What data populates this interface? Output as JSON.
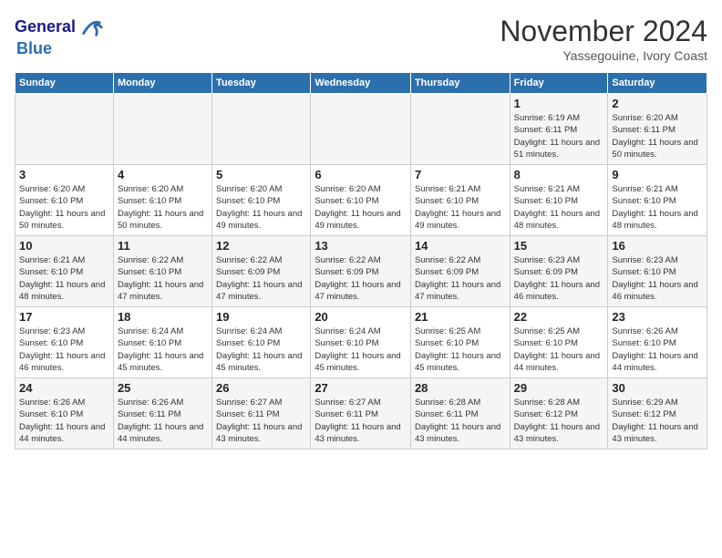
{
  "header": {
    "logo_line1": "General",
    "logo_line2": "Blue",
    "month_title": "November 2024",
    "subtitle": "Yassegouine, Ivory Coast"
  },
  "weekdays": [
    "Sunday",
    "Monday",
    "Tuesday",
    "Wednesday",
    "Thursday",
    "Friday",
    "Saturday"
  ],
  "weeks": [
    [
      {
        "day": "",
        "info": ""
      },
      {
        "day": "",
        "info": ""
      },
      {
        "day": "",
        "info": ""
      },
      {
        "day": "",
        "info": ""
      },
      {
        "day": "",
        "info": ""
      },
      {
        "day": "1",
        "info": "Sunrise: 6:19 AM\nSunset: 6:11 PM\nDaylight: 11 hours and 51 minutes."
      },
      {
        "day": "2",
        "info": "Sunrise: 6:20 AM\nSunset: 6:11 PM\nDaylight: 11 hours and 50 minutes."
      }
    ],
    [
      {
        "day": "3",
        "info": "Sunrise: 6:20 AM\nSunset: 6:10 PM\nDaylight: 11 hours and 50 minutes."
      },
      {
        "day": "4",
        "info": "Sunrise: 6:20 AM\nSunset: 6:10 PM\nDaylight: 11 hours and 50 minutes."
      },
      {
        "day": "5",
        "info": "Sunrise: 6:20 AM\nSunset: 6:10 PM\nDaylight: 11 hours and 49 minutes."
      },
      {
        "day": "6",
        "info": "Sunrise: 6:20 AM\nSunset: 6:10 PM\nDaylight: 11 hours and 49 minutes."
      },
      {
        "day": "7",
        "info": "Sunrise: 6:21 AM\nSunset: 6:10 PM\nDaylight: 11 hours and 49 minutes."
      },
      {
        "day": "8",
        "info": "Sunrise: 6:21 AM\nSunset: 6:10 PM\nDaylight: 11 hours and 48 minutes."
      },
      {
        "day": "9",
        "info": "Sunrise: 6:21 AM\nSunset: 6:10 PM\nDaylight: 11 hours and 48 minutes."
      }
    ],
    [
      {
        "day": "10",
        "info": "Sunrise: 6:21 AM\nSunset: 6:10 PM\nDaylight: 11 hours and 48 minutes."
      },
      {
        "day": "11",
        "info": "Sunrise: 6:22 AM\nSunset: 6:10 PM\nDaylight: 11 hours and 47 minutes."
      },
      {
        "day": "12",
        "info": "Sunrise: 6:22 AM\nSunset: 6:09 PM\nDaylight: 11 hours and 47 minutes."
      },
      {
        "day": "13",
        "info": "Sunrise: 6:22 AM\nSunset: 6:09 PM\nDaylight: 11 hours and 47 minutes."
      },
      {
        "day": "14",
        "info": "Sunrise: 6:22 AM\nSunset: 6:09 PM\nDaylight: 11 hours and 47 minutes."
      },
      {
        "day": "15",
        "info": "Sunrise: 6:23 AM\nSunset: 6:09 PM\nDaylight: 11 hours and 46 minutes."
      },
      {
        "day": "16",
        "info": "Sunrise: 6:23 AM\nSunset: 6:10 PM\nDaylight: 11 hours and 46 minutes."
      }
    ],
    [
      {
        "day": "17",
        "info": "Sunrise: 6:23 AM\nSunset: 6:10 PM\nDaylight: 11 hours and 46 minutes."
      },
      {
        "day": "18",
        "info": "Sunrise: 6:24 AM\nSunset: 6:10 PM\nDaylight: 11 hours and 45 minutes."
      },
      {
        "day": "19",
        "info": "Sunrise: 6:24 AM\nSunset: 6:10 PM\nDaylight: 11 hours and 45 minutes."
      },
      {
        "day": "20",
        "info": "Sunrise: 6:24 AM\nSunset: 6:10 PM\nDaylight: 11 hours and 45 minutes."
      },
      {
        "day": "21",
        "info": "Sunrise: 6:25 AM\nSunset: 6:10 PM\nDaylight: 11 hours and 45 minutes."
      },
      {
        "day": "22",
        "info": "Sunrise: 6:25 AM\nSunset: 6:10 PM\nDaylight: 11 hours and 44 minutes."
      },
      {
        "day": "23",
        "info": "Sunrise: 6:26 AM\nSunset: 6:10 PM\nDaylight: 11 hours and 44 minutes."
      }
    ],
    [
      {
        "day": "24",
        "info": "Sunrise: 6:26 AM\nSunset: 6:10 PM\nDaylight: 11 hours and 44 minutes."
      },
      {
        "day": "25",
        "info": "Sunrise: 6:26 AM\nSunset: 6:11 PM\nDaylight: 11 hours and 44 minutes."
      },
      {
        "day": "26",
        "info": "Sunrise: 6:27 AM\nSunset: 6:11 PM\nDaylight: 11 hours and 43 minutes."
      },
      {
        "day": "27",
        "info": "Sunrise: 6:27 AM\nSunset: 6:11 PM\nDaylight: 11 hours and 43 minutes."
      },
      {
        "day": "28",
        "info": "Sunrise: 6:28 AM\nSunset: 6:11 PM\nDaylight: 11 hours and 43 minutes."
      },
      {
        "day": "29",
        "info": "Sunrise: 6:28 AM\nSunset: 6:12 PM\nDaylight: 11 hours and 43 minutes."
      },
      {
        "day": "30",
        "info": "Sunrise: 6:29 AM\nSunset: 6:12 PM\nDaylight: 11 hours and 43 minutes."
      }
    ]
  ]
}
